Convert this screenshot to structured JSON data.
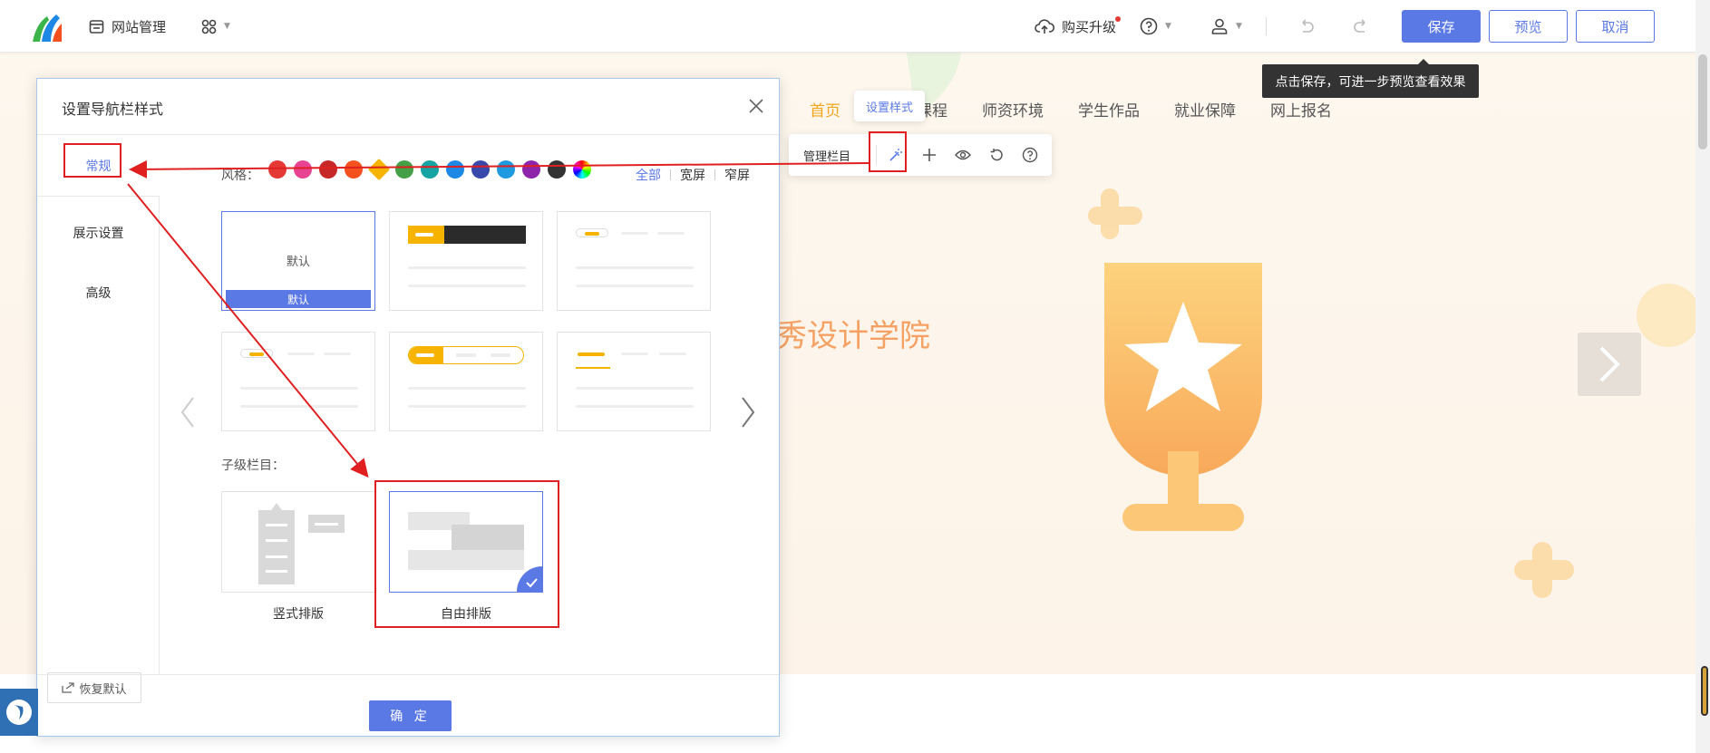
{
  "topbar": {
    "site_manage": "网站管理",
    "upgrade": "购买升级",
    "save": "保存",
    "preview": "预览",
    "cancel": "取消",
    "save_tip": "点击保存，可进一步预览查看效果"
  },
  "site": {
    "nav": [
      "首页",
      "课程",
      "师资环境",
      "学生作品",
      "就业保障",
      "网上报名"
    ],
    "hero_title": "秀设计学院"
  },
  "column_toolbar": {
    "set_style_tip": "设置样式",
    "manage_label": "管理栏目"
  },
  "modal": {
    "title": "设置导航栏样式",
    "side": {
      "general": "常规",
      "display": "展示设置",
      "advanced": "高级"
    },
    "style_label": "风格：",
    "filters": {
      "all": "全部",
      "wide": "宽屏",
      "narrow": "窄屏"
    },
    "swatches": [
      "#e53935",
      "#e84393",
      "#c62828",
      "#f4511e",
      "#f6b300",
      "#43a047",
      "#16a3a3",
      "#1e88e5",
      "#3949ab",
      "#1e9be0",
      "#8e24aa",
      "#333333",
      "rainbow"
    ],
    "card_default_text": "默认",
    "card_default_bar": "默认",
    "sub_label": "子级栏目：",
    "sub_vertical": "竖式排版",
    "sub_free": "自由排版",
    "restore": "恢复默认",
    "ok": "确 定"
  },
  "colors": {
    "accent": "#5b79e5",
    "nav_active": "#f2a61c",
    "annotation": "#e02020"
  }
}
